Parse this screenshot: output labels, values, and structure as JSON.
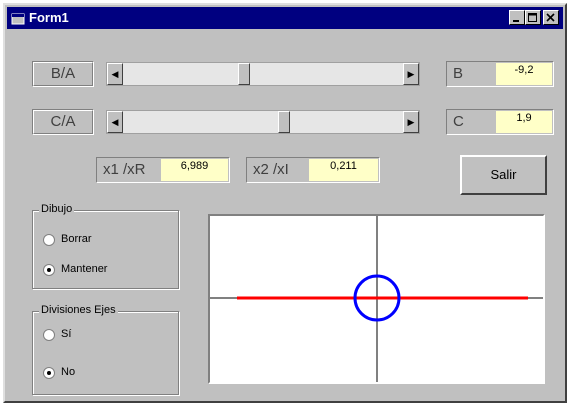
{
  "window": {
    "title": "Form1",
    "icon": "app-form-icon",
    "controls": [
      "minimize-icon",
      "maximize-icon",
      "close-icon"
    ]
  },
  "sliders": [
    {
      "label": "B/A",
      "level": 0.43,
      "icon_left": "left-arrow-icon",
      "icon_right": "right-arrow-icon"
    },
    {
      "label": "C/A",
      "level": 0.58,
      "icon_left": "left-arrow-icon",
      "icon_right": "right-arrow-icon"
    }
  ],
  "values": {
    "b": {
      "label": "B",
      "value": "-9,2"
    },
    "c": {
      "label": "C",
      "value": "1,9"
    },
    "x1": {
      "label": "x1 /xR",
      "value": "6,989"
    },
    "x2": {
      "label": "x2 /xI",
      "value": "0,211"
    }
  },
  "buttons": {
    "exit": "Salir"
  },
  "groups": {
    "dibujo": {
      "title": "Dibujo",
      "options": [
        "Borrar",
        "Mantener"
      ],
      "selected": 1
    },
    "divisiones": {
      "title": "Divisiones Ejes",
      "options": [
        "Sí",
        "No"
      ],
      "selected": 1
    }
  },
  "plot": {
    "x_axis": true,
    "y_axis": true,
    "line_color": "#ff0000",
    "circle_color": "#0000ff",
    "axis_color": "#000000"
  },
  "colors": {
    "titlebar": "#000080",
    "face": "#c0c0c0",
    "value_bg": "#ffffc8"
  }
}
